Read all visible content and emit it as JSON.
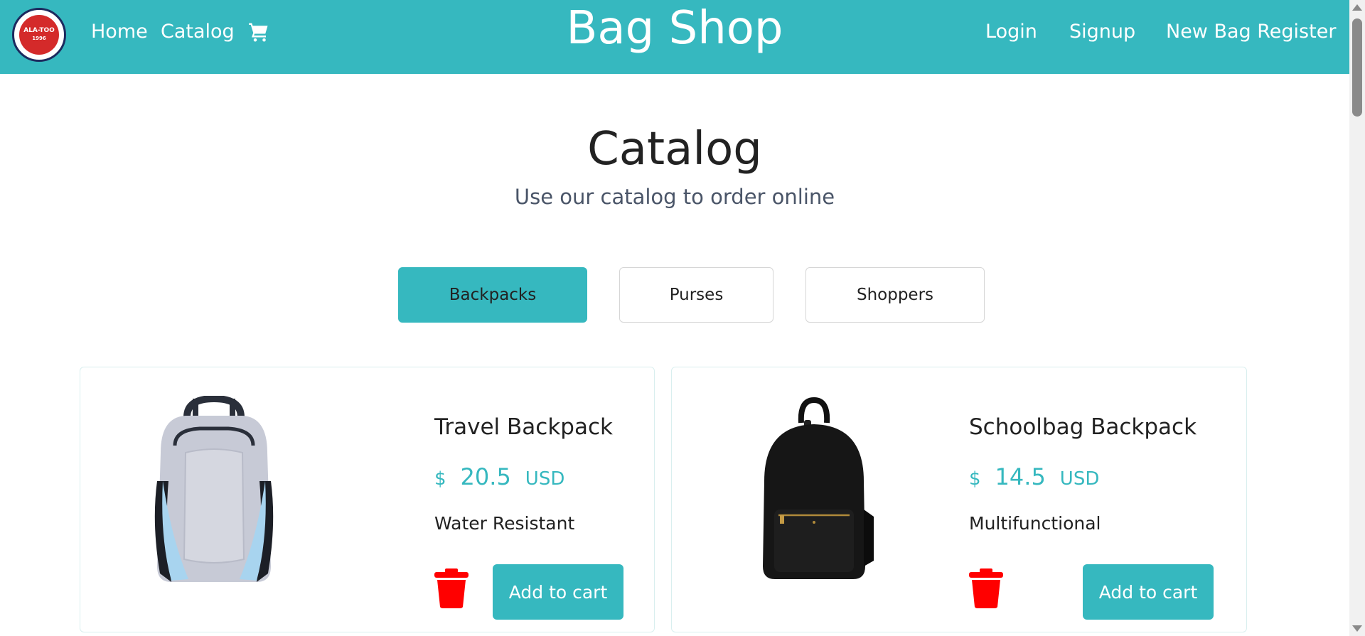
{
  "navbar": {
    "logo": {
      "text": "ALA-TOO",
      "year": "1996"
    },
    "links": {
      "home": "Home",
      "catalog": "Catalog",
      "login": "Login",
      "signup": "Signup",
      "new_bag": "New Bag Register"
    },
    "brand": "Bag Shop",
    "color": "#36b8bf"
  },
  "main": {
    "title": "Catalog",
    "subtitle": "Use our catalog to order online",
    "tabs": [
      {
        "label": "Backpacks",
        "active": true
      },
      {
        "label": "Purses",
        "active": false
      },
      {
        "label": "Shoppers",
        "active": false
      }
    ],
    "products": [
      {
        "name": "Travel Backpack",
        "currency_symbol": "$",
        "price": "20.5",
        "currency": "USD",
        "feature": "Water Resistant",
        "add_label": "Add to cart",
        "image": "grey-blue-backpack"
      },
      {
        "name": "Schoolbag Backpack",
        "currency_symbol": "$",
        "price": "14.5",
        "currency": "USD",
        "feature": "Multifunctional",
        "add_label": "Add to cart",
        "image": "black-backpack"
      }
    ]
  },
  "colors": {
    "accent": "#36b8bf",
    "delete": "#ff0000",
    "text": "#222222"
  }
}
